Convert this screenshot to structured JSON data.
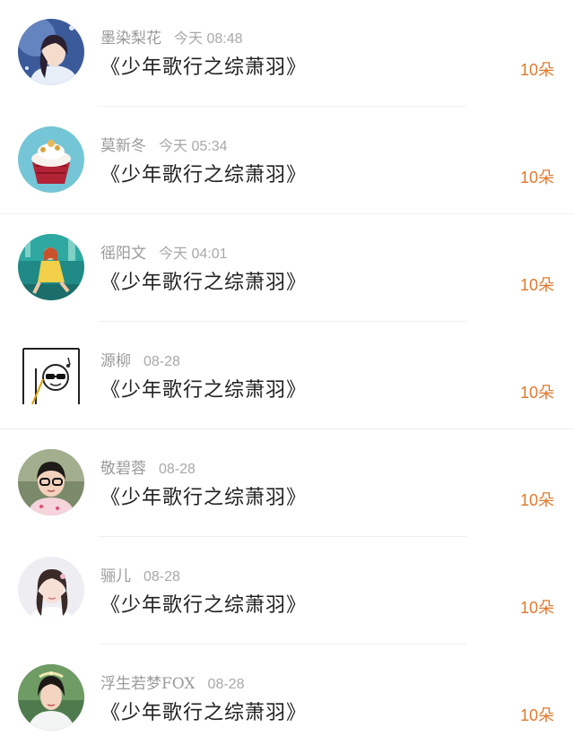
{
  "gifts": [
    {
      "user": "墨染梨花",
      "time": "今天 08:48",
      "title": "《少年歌行之综萧羽》",
      "amount": "10朵",
      "avatar_icon": "girl-moon-avatar-icon"
    },
    {
      "user": "莫新冬",
      "time": "今天 05:34",
      "title": "《少年歌行之综萧羽》",
      "amount": "10朵",
      "avatar_icon": "cupcake-avatar-icon"
    },
    {
      "user": "徭阳文",
      "time": "今天 04:01",
      "title": "《少年歌行之综萧羽》",
      "amount": "10朵",
      "avatar_icon": "illustrated-girl-avatar-icon"
    },
    {
      "user": "源柳",
      "time": "08-28",
      "title": "《少年歌行之综萧羽》",
      "amount": "10朵",
      "avatar_icon": "doodle-avatar-icon"
    },
    {
      "user": "敬碧蓉",
      "time": "08-28",
      "title": "《少年歌行之综萧羽》",
      "amount": "10朵",
      "avatar_icon": "child-glasses-avatar-icon"
    },
    {
      "user": "骊儿",
      "time": "08-28",
      "title": "《少年歌行之综萧羽》",
      "amount": "10朵",
      "avatar_icon": "girl-portrait-avatar-icon"
    },
    {
      "user": "浮生若梦FOX",
      "time": "08-28",
      "title": "《少年歌行之综萧羽》",
      "amount": "10朵",
      "avatar_icon": "costume-girl-avatar-icon"
    }
  ],
  "colors": {
    "accent": "#e07a2e",
    "meta": "#9a9a9a",
    "title": "#222222",
    "divider": "#f0f0f0"
  }
}
